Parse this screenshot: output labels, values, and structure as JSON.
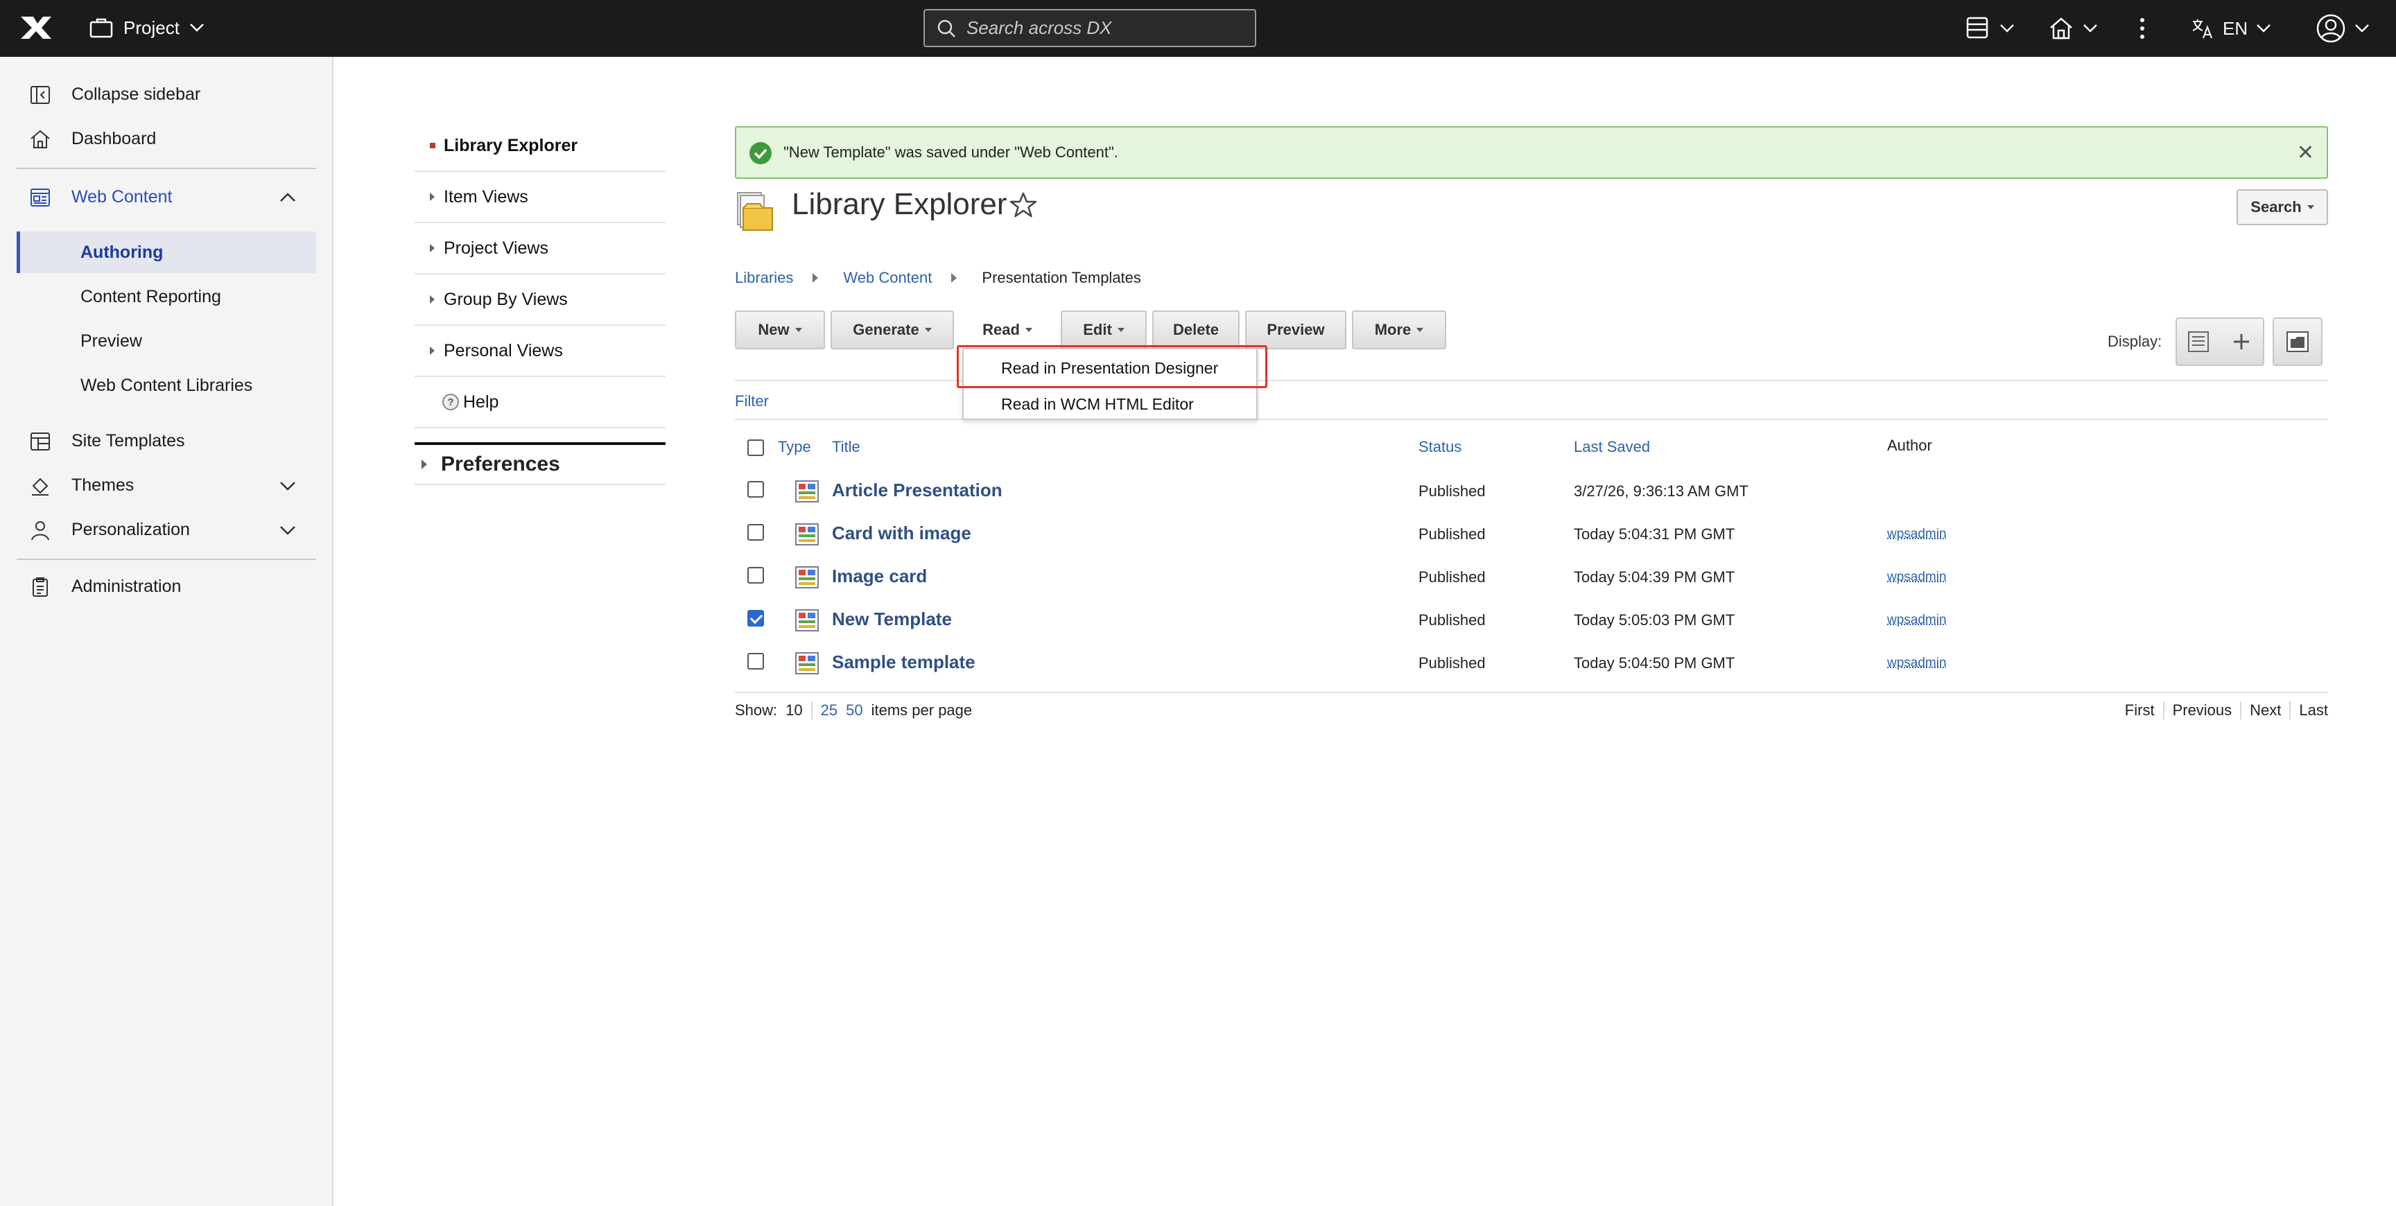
{
  "topbar": {
    "project_label": "Project",
    "search_placeholder": "Search across DX",
    "language": "EN"
  },
  "sidebar": {
    "collapse": "Collapse sidebar",
    "dashboard": "Dashboard",
    "web_content": "Web Content",
    "web_content_items": [
      "Authoring",
      "Content Reporting",
      "Preview",
      "Web Content Libraries"
    ],
    "site_templates": "Site Templates",
    "themes": "Themes",
    "personalization": "Personalization",
    "administration": "Administration"
  },
  "left_nav": {
    "items": [
      "Library Explorer",
      "Item Views",
      "Project Views",
      "Group By Views",
      "Personal Views"
    ],
    "help": "Help",
    "preferences": "Preferences"
  },
  "alert": {
    "message": "\"New Template\" was saved under \"Web Content\"."
  },
  "page": {
    "title": "Library Explorer",
    "search_button": "Search"
  },
  "breadcrumb": [
    "Libraries",
    "Web Content",
    "Presentation Templates"
  ],
  "toolbar": {
    "new": "New",
    "generate": "Generate",
    "read": "Read",
    "edit": "Edit",
    "delete": "Delete",
    "preview": "Preview",
    "more": "More",
    "display_label": "Display:"
  },
  "read_menu": [
    "Read in Presentation Designer",
    "Read in WCM HTML Editor"
  ],
  "filter": "Filter",
  "table": {
    "columns": {
      "type": "Type",
      "title": "Title",
      "status": "Status",
      "last_saved": "Last Saved",
      "author": "Author"
    },
    "rows": [
      {
        "title": "Article Presentation",
        "status": "Published",
        "last_saved": "3/27/26, 9:36:13 AM GMT",
        "author": "",
        "checked": false
      },
      {
        "title": "Card with image",
        "status": "Published",
        "last_saved": "Today 5:04:31 PM GMT",
        "author": "wpsadmin",
        "checked": false
      },
      {
        "title": "Image card",
        "status": "Published",
        "last_saved": "Today 5:04:39 PM GMT",
        "author": "wpsadmin",
        "checked": false
      },
      {
        "title": "New Template",
        "status": "Published",
        "last_saved": "Today 5:05:03 PM GMT",
        "author": "wpsadmin",
        "checked": true
      },
      {
        "title": "Sample template",
        "status": "Published",
        "last_saved": "Today 5:04:50 PM GMT",
        "author": "wpsadmin",
        "checked": false
      }
    ]
  },
  "pager": {
    "show_label": "Show:",
    "options": [
      "10",
      "25",
      "50"
    ],
    "per_page": "items per page",
    "first": "First",
    "previous": "Previous",
    "next": "Next",
    "last": "Last"
  },
  "colors": {
    "accent": "#2c4bbd",
    "topbar": "#1b1b1b",
    "success_bg": "#e5f4dd",
    "highlight": "#e03426"
  }
}
